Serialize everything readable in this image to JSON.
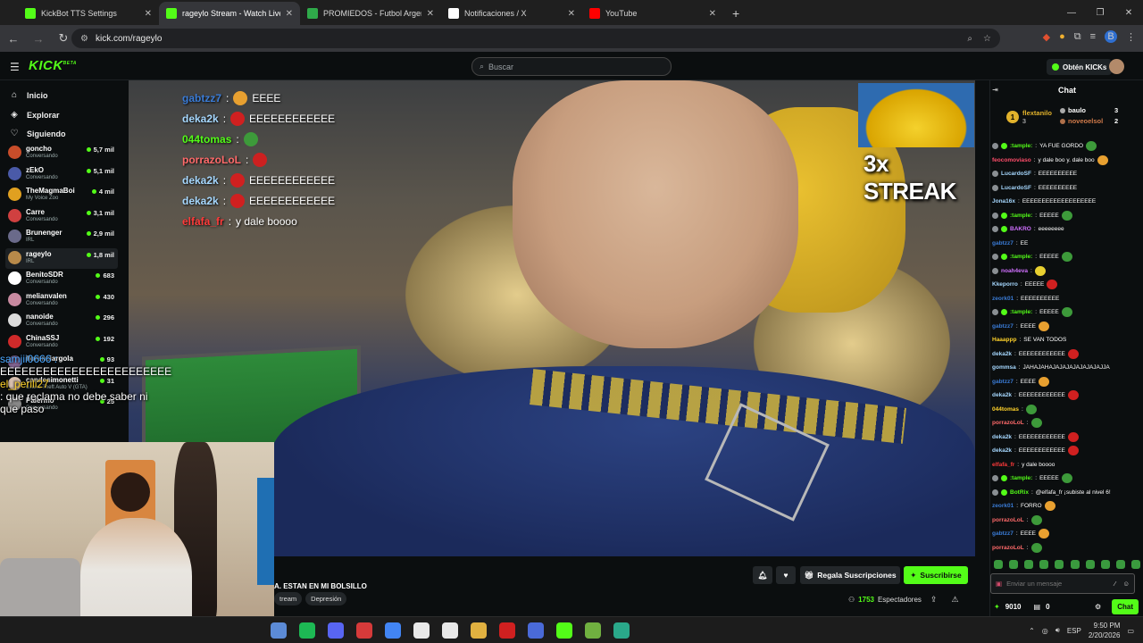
{
  "browser": {
    "tabs": [
      {
        "title": "KickBot TTS Settings",
        "color": "#53fc18"
      },
      {
        "title": "rageylo Stream - Watch Live",
        "color": "#53fc18"
      },
      {
        "title": "PROMIEDOS - Futbol Argentino",
        "color": "#2faa4a"
      },
      {
        "title": "Notificaciones / X",
        "color": "#ffffff"
      },
      {
        "title": "YouTube",
        "color": "#ff0000"
      }
    ],
    "url": "kick.com/rageylo"
  },
  "kick": {
    "logo": "KICK",
    "search_placeholder": "Buscar",
    "get_kicks": "Obtén KICKs"
  },
  "sidebar": {
    "nav": [
      "Inicio",
      "Explorar",
      "Siguiendo"
    ],
    "channels": [
      {
        "name": "goncho",
        "category": "Conversando",
        "viewers": "5,7 mil",
        "color": "#c84d2a"
      },
      {
        "name": "zEkO",
        "category": "Conversando",
        "viewers": "5,1 mil",
        "color": "#4a5aa8"
      },
      {
        "name": "TheMagmaBoi",
        "category": "My Voice Zoo",
        "viewers": "4 mil",
        "color": "#e0a020"
      },
      {
        "name": "Carre",
        "category": "Conversando",
        "viewers": "3,1 mil",
        "color": "#d04040"
      },
      {
        "name": "Brunenger",
        "category": "IRL",
        "viewers": "2,9 mil",
        "color": "#6a6a8a"
      },
      {
        "name": "rageylo",
        "category": "IRL",
        "viewers": "1,8 mil",
        "color": "#b88a4a"
      },
      {
        "name": "BenitoSDR",
        "category": "Conversando",
        "viewers": "683",
        "color": "#ffffff"
      },
      {
        "name": "melianvalen",
        "category": "Conversando",
        "viewers": "430",
        "color": "#c88aa0"
      },
      {
        "name": "nanoide",
        "category": "Conversando",
        "viewers": "296",
        "color": "#dcdcdc"
      },
      {
        "name": "ChinaSSJ",
        "category": "Conversando",
        "viewers": "192",
        "color": "#d02a2a"
      },
      {
        "name": "florenciargola",
        "category": "",
        "viewers": "93",
        "color": "#8a6a9a"
      },
      {
        "name": "candesimonetti",
        "category": "Grand Theft Auto V (GTA)",
        "viewers": "31",
        "color": "#d8c0b0"
      },
      {
        "name": "Palermo",
        "category": "Conversando",
        "viewers": "25",
        "color": "#888888"
      }
    ]
  },
  "overlay": {
    "chat": [
      {
        "user": "gabtzz7",
        "color": "#3a7bd5",
        "text": "EEEE",
        "emote": "#e8a030"
      },
      {
        "user": "deka2k",
        "color": "#a6d8ff",
        "text": "EEEEEEEEEEEE",
        "emote": "#d02020"
      },
      {
        "user": "044tomas",
        "color": "#53fc18",
        "text": "",
        "emote": "#3d9a3a"
      },
      {
        "user": "porrazoLoL",
        "color": "#ff6a6a",
        "text": "",
        "emote": "#cc2020"
      },
      {
        "user": "deka2k",
        "color": "#a6d8ff",
        "text": "EEEEEEEEEEEE",
        "emote": "#d02020"
      },
      {
        "user": "deka2k",
        "color": "#a6d8ff",
        "text": "EEEEEEEEEEEE",
        "emote": "#d02020"
      },
      {
        "user": "elfafa_fr",
        "color": "#ff3a3a",
        "text": "y dale boooo",
        "emote": ""
      }
    ],
    "streak": "3x STREAK",
    "webcam_chat": [
      {
        "text": "samjii0666 :",
        "color": "#4aa8ff"
      },
      {
        "text": "EEEEEEEEEEEEEEEEEEEEEEEE",
        "color": "#ffffff"
      },
      {
        "text": "el_perili27",
        "color": "#ffd22a"
      },
      {
        "text": ": que reclama no debe saber ni",
        "color": "#ffffff"
      },
      {
        "text": "que paso",
        "color": "#ffffff"
      }
    ]
  },
  "info": {
    "title": "A. ESTAN EN MI BOLSILLO",
    "tags": [
      "tream",
      "Depresión"
    ],
    "gift_label": "Regala Suscripciones",
    "subscribe_label": "Suscribirse",
    "viewers": "1753",
    "viewers_label": "Espectadores"
  },
  "chat": {
    "title": "Chat",
    "leaderboard": {
      "first": {
        "name": "flextanilo",
        "count": "3"
      },
      "second": {
        "name": "baulo",
        "count": "3"
      },
      "third": {
        "name": "noveoelsol",
        "count": "2"
      }
    },
    "messages": [
      {
        "user": ":tample:",
        "color": "#53fc18",
        "text": "YA FUE GORDO",
        "emote": "#3d9a3a",
        "badges": 2
      },
      {
        "user": "feocomoviaso",
        "color": "#ff4d6a",
        "text": "y dale boo y. dale boo",
        "emote": "#e8a030",
        "badges": 0
      },
      {
        "user": "LucardoSF",
        "color": "#a6d8ff",
        "text": "EEEEEEEEEE",
        "emote": "",
        "badges": 1
      },
      {
        "user": "LucardoSF",
        "color": "#a6d8ff",
        "text": "EEEEEEEEEE",
        "emote": "",
        "badges": 1
      },
      {
        "user": "Jona16x",
        "color": "#a6d8ff",
        "text": "EEEEEEEEEEEEEEEEEEE",
        "emote": "",
        "badges": 0
      },
      {
        "user": ":tample:",
        "color": "#53fc18",
        "text": "EEEEE",
        "emote": "#3d9a3a",
        "badges": 2
      },
      {
        "user": "BAKRO",
        "color": "#d070ff",
        "text": "eeeeeeee",
        "emote": "",
        "badges": 2
      },
      {
        "user": "gabtzz7",
        "color": "#3a7bd5",
        "text": "EE",
        "emote": "",
        "badges": 0
      },
      {
        "user": ":tample:",
        "color": "#53fc18",
        "text": "EEEEE",
        "emote": "#3d9a3a",
        "badges": 2
      },
      {
        "user": "noah4eva",
        "color": "#d070ff",
        "text": "",
        "emote": "#e8d030",
        "badges": 1
      },
      {
        "user": "Kkeporro",
        "color": "#a6d8ff",
        "text": "EEEEE",
        "emote": "#d02020",
        "badges": 0
      },
      {
        "user": "zeork01",
        "color": "#3a7bd5",
        "text": "EEEEEEEEEE",
        "emote": "",
        "badges": 0
      },
      {
        "user": ":tample:",
        "color": "#53fc18",
        "text": "EEEEE",
        "emote": "#3d9a3a",
        "badges": 2
      },
      {
        "user": "gabtzz7",
        "color": "#3a7bd5",
        "text": "EEEE",
        "emote": "#e8a030",
        "badges": 0
      },
      {
        "user": "Haaappp",
        "color": "#ffd22a",
        "text": "SE VAN TODOS",
        "emote": "",
        "badges": 0
      },
      {
        "user": "deka2k",
        "color": "#a6d8ff",
        "text": "EEEEEEEEEEEE",
        "emote": "#d02020",
        "badges": 0
      },
      {
        "user": "gommsa",
        "color": "#a6d8ff",
        "text": "JAHAJAHAJAJAJAJAJAJAJAJJA",
        "emote": "",
        "badges": 0
      },
      {
        "user": "gabtzz7",
        "color": "#3a7bd5",
        "text": "EEEE",
        "emote": "#e8a030",
        "badges": 0
      },
      {
        "user": "deka2k",
        "color": "#a6d8ff",
        "text": "EEEEEEEEEEEE",
        "emote": "#d02020",
        "badges": 0
      },
      {
        "user": "044tomas",
        "color": "#ffd22a",
        "text": "",
        "emote": "#3d9a3a",
        "badges": 0
      },
      {
        "user": "porrazoLoL",
        "color": "#ff6a6a",
        "text": "",
        "emote": "#3d9a3a",
        "badges": 0
      },
      {
        "user": "deka2k",
        "color": "#a6d8ff",
        "text": "EEEEEEEEEEEE",
        "emote": "#d02020",
        "badges": 0
      },
      {
        "user": "deka2k",
        "color": "#a6d8ff",
        "text": "EEEEEEEEEEEE",
        "emote": "#d02020",
        "badges": 0
      },
      {
        "user": "elfafa_fr",
        "color": "#ff3a3a",
        "text": "y dale boooo",
        "emote": "",
        "badges": 0
      },
      {
        "user": ":tample:",
        "color": "#53fc18",
        "text": "EEEEE",
        "emote": "#3d9a3a",
        "badges": 2
      },
      {
        "user": "BotRix",
        "color": "#53fc18",
        "text": "@elfafa_fr ¡subiste al nivel 6!",
        "emote": "",
        "badges": 2
      },
      {
        "user": "zeork01",
        "color": "#3a7bd5",
        "text": "FORRO",
        "emote": "#e8a030",
        "badges": 0
      },
      {
        "user": "porrazoLoL",
        "color": "#ff6a6a",
        "text": "",
        "emote": "#3d9a3a",
        "badges": 0
      },
      {
        "user": "gabtzz7",
        "color": "#3a7bd5",
        "text": "EEEE",
        "emote": "#e8a030",
        "badges": 0
      },
      {
        "user": "porrazoLoL",
        "color": "#ff6a6a",
        "text": "",
        "emote": "#3d9a3a",
        "badges": 0
      }
    ],
    "input_placeholder": "Enviar un mensaje",
    "points": "9010",
    "gifts": "0",
    "send_label": "Chat"
  },
  "taskbar": {
    "lang": "ESP",
    "time": "9:50 PM",
    "date": "2/20/2026",
    "apps": [
      "#5c8bd6",
      "#1db954",
      "#5865f2",
      "#d63a3a",
      "#4285f4",
      "#e8e8e8",
      "#e8e8e8",
      "#e0b040",
      "#d02020",
      "#4a6ad8",
      "#53fc18",
      "#70b040",
      "#2aa88a"
    ]
  }
}
